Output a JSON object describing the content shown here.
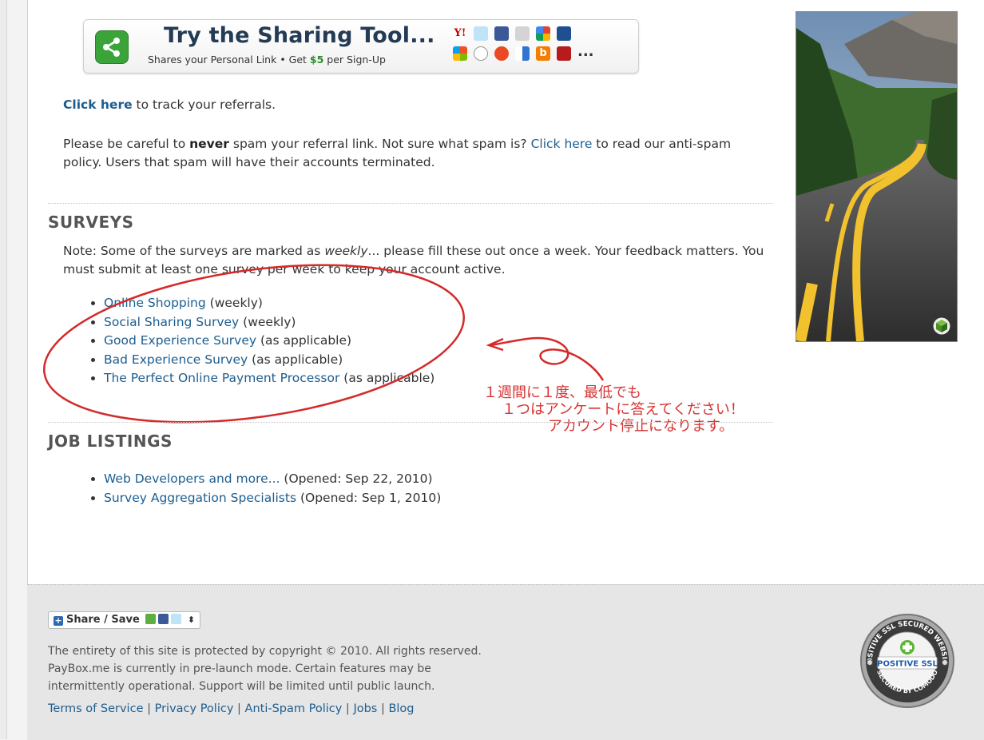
{
  "banner": {
    "title": "Try the Sharing Tool...",
    "subtitle_pre": "Shares your Personal Link  •  Get ",
    "subtitle_money": "$5",
    "subtitle_post": " per Sign-Up",
    "more": "...",
    "service_icons": [
      "yahoo-icon",
      "twitter-icon",
      "facebook-icon",
      "delicious-icon",
      "google-icon",
      "myspace-icon",
      "windows-live-icon",
      "reddit-icon",
      "stumbleupon-icon",
      "delicious-squares-icon",
      "blogger-icon",
      "digg-icon"
    ]
  },
  "track": {
    "link": "Click here",
    "text": " to track your referrals."
  },
  "spam": {
    "pre": "Please be careful to ",
    "bold": "never",
    "mid": " spam your referral link. Not sure what spam is? ",
    "link": "Click here",
    "post": " to read our anti-spam policy. Users that spam will have their accounts terminated."
  },
  "surveys": {
    "heading": "SURVEYS",
    "note_pre": "Note: Some of the surveys are marked as ",
    "note_em": "weekly",
    "note_post": "... please fill these out once a week. Your feedback matters. You must submit at least one survey per week to keep your account active.",
    "items": [
      {
        "link": "Online Shopping",
        "tag": " (weekly)"
      },
      {
        "link": "Social Sharing Survey",
        "tag": " (weekly)"
      },
      {
        "link": "Good Experience Survey",
        "tag": " (as applicable)"
      },
      {
        "link": "Bad Experience Survey",
        "tag": " (as applicable)"
      },
      {
        "link": "The Perfect Online Payment Processor",
        "tag": " (as applicable)"
      }
    ]
  },
  "annotation": {
    "line1": "１週間に１度、最低でも",
    "line2": "１つはアンケートに答えてください！",
    "line3": "アカウント停止になります。",
    "color": "#d83232"
  },
  "jobs": {
    "heading": "JOB LISTINGS",
    "items": [
      {
        "link": "Web Developers and more...",
        "tag": " (Opened: Sep 22, 2010)"
      },
      {
        "link": "Survey Aggregation Specialists",
        "tag": " (Opened: Sep 1, 2010)"
      }
    ]
  },
  "footer": {
    "share_label": "Share / Save",
    "copyright_1": "The entirety of this site is protected by copyright © 2010. All rights reserved.",
    "copyright_2": "PayBox.me is currently in pre-launch mode. Certain features may be",
    "copyright_3": "intermittently operational. Support will be limited until public launch.",
    "links": [
      "Terms of Service",
      "Privacy Policy",
      "Anti-Spam Policy",
      "Jobs",
      "Blog"
    ],
    "separator": " | ",
    "seal_top": "POSITIVE SSL SECURED WEBSITE",
    "seal_mid": "POSITIVE SSL",
    "seal_bottom": "SECURED BY COMODO"
  },
  "colors": {
    "link": "#1c5d8f",
    "heading": "#555555",
    "footer_bg": "#e6e6e6",
    "annotation": "#d83232"
  }
}
